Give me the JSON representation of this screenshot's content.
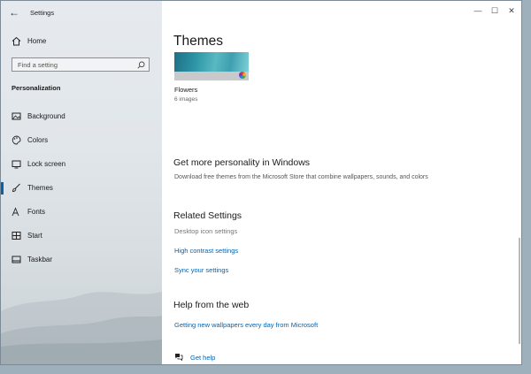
{
  "window": {
    "app_title": "Settings",
    "controls": {
      "minimize": "—",
      "maximize": "☐",
      "close": "✕"
    }
  },
  "sidebar": {
    "back_glyph": "←",
    "home_label": "Home",
    "search_placeholder": "Find a setting",
    "section_title": "Personalization",
    "items": [
      {
        "label": "Background",
        "icon": "picture-icon"
      },
      {
        "label": "Colors",
        "icon": "palette-icon"
      },
      {
        "label": "Lock screen",
        "icon": "lock-screen-icon"
      },
      {
        "label": "Themes",
        "icon": "brush-icon",
        "active": true
      },
      {
        "label": "Fonts",
        "icon": "font-icon"
      },
      {
        "label": "Start",
        "icon": "start-grid-icon"
      },
      {
        "label": "Taskbar",
        "icon": "taskbar-icon"
      }
    ]
  },
  "main": {
    "title": "Themes",
    "theme": {
      "name": "Flowers",
      "count": "6 images"
    },
    "personality": {
      "heading": "Get more personality in Windows",
      "description": "Download free themes from the Microsoft Store that combine wallpapers, sounds, and colors"
    },
    "related": {
      "heading": "Related Settings",
      "desktop_icons": "Desktop icon settings",
      "high_contrast": "High contrast settings",
      "sync": "Sync your settings"
    },
    "help": {
      "heading": "Help from the web",
      "wallpapers_link": "Getting new wallpapers every day from Microsoft",
      "get_help": "Get help"
    }
  },
  "colors": {
    "accent": "#0063b1",
    "link": "#0063b1"
  }
}
